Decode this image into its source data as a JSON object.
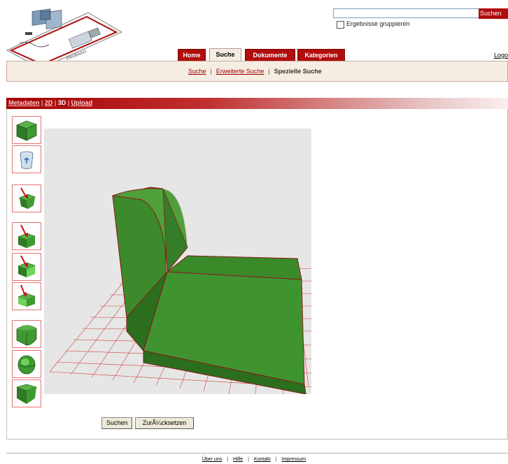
{
  "search": {
    "placeholder": "",
    "button_label": "Suchen",
    "group_label": "Ergebnisse gruppieren",
    "group_checked": false
  },
  "tabs": [
    {
      "label": "Home",
      "active": false
    },
    {
      "label": "Suche",
      "active": true
    },
    {
      "label": "Dokumente",
      "active": false
    },
    {
      "label": "Kategorien",
      "active": false
    }
  ],
  "logout_label": "Logo",
  "subnav": {
    "links": [
      "Suche",
      "Erweiterte Suche"
    ],
    "current": "Spezielle Suche",
    "separator": "|"
  },
  "modebar": {
    "items": [
      "Metadaten",
      "2D",
      "3D",
      "Upload"
    ],
    "active": "3D",
    "separator": "|"
  },
  "tools": [
    {
      "icon": "cube-icon"
    },
    {
      "icon": "trash-icon"
    },
    {
      "icon": "pull-face-icon"
    },
    {
      "icon": "push-face-top-icon"
    },
    {
      "icon": "push-face-side-icon"
    },
    {
      "icon": "push-face-front-icon"
    },
    {
      "icon": "round-edge-icon"
    },
    {
      "icon": "sphere-cut-icon"
    },
    {
      "icon": "chamfer-icon"
    }
  ],
  "buttons": {
    "search_label": "Suchen",
    "reset_label": "ZurÃ¼cksetzen"
  },
  "footer": {
    "links": [
      "Über uns",
      "Hilfe",
      "Kontakt",
      "Impressum"
    ],
    "separator": "|"
  },
  "colors": {
    "brand_red": "#b00d0d",
    "subnav_bg": "#f6ede2",
    "model_green": "#3a8a2a",
    "grid_red": "#d04040"
  }
}
